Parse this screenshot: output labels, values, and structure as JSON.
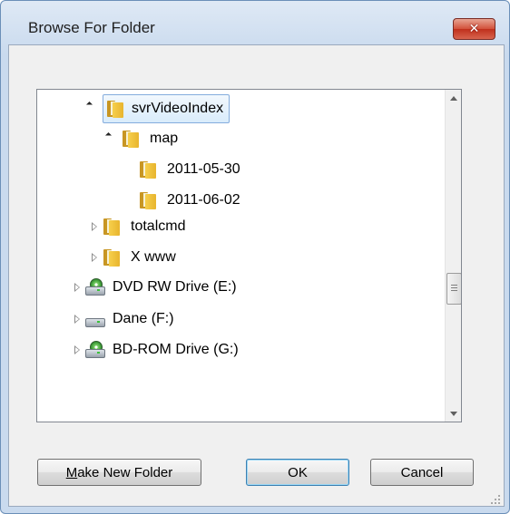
{
  "window": {
    "title": "Browse For Folder"
  },
  "titlebar": {
    "close_symbol": "✕"
  },
  "tree": {
    "items": [
      {
        "label": "svrVideoIndex",
        "icon": "folder-icon",
        "expander": "expanded",
        "selected": true
      },
      {
        "label": "map",
        "icon": "folder-icon",
        "expander": "expanded"
      },
      {
        "label": "2011-05-30",
        "icon": "folder-icon",
        "expander": "none"
      },
      {
        "label": "2011-06-02",
        "icon": "folder-icon",
        "expander": "none"
      },
      {
        "label": "totalcmd",
        "icon": "folder-icon",
        "expander": "collapsed"
      },
      {
        "label": "X www",
        "icon": "folder-icon",
        "expander": "collapsed"
      },
      {
        "label": "DVD RW Drive (E:)",
        "icon": "optical-drive-icon",
        "expander": "collapsed"
      },
      {
        "label": "Dane (F:)",
        "icon": "hard-drive-icon",
        "expander": "collapsed"
      },
      {
        "label": "BD-ROM Drive (G:)",
        "icon": "optical-drive-icon",
        "expander": "collapsed"
      }
    ]
  },
  "buttons": {
    "make_new_folder": {
      "accel": "M",
      "rest": "ake New Folder"
    },
    "ok": "OK",
    "cancel": "Cancel"
  },
  "colors": {
    "selection": "#d9ecfb",
    "folder": "#f6cf4c",
    "close_button": "#c0301c"
  }
}
